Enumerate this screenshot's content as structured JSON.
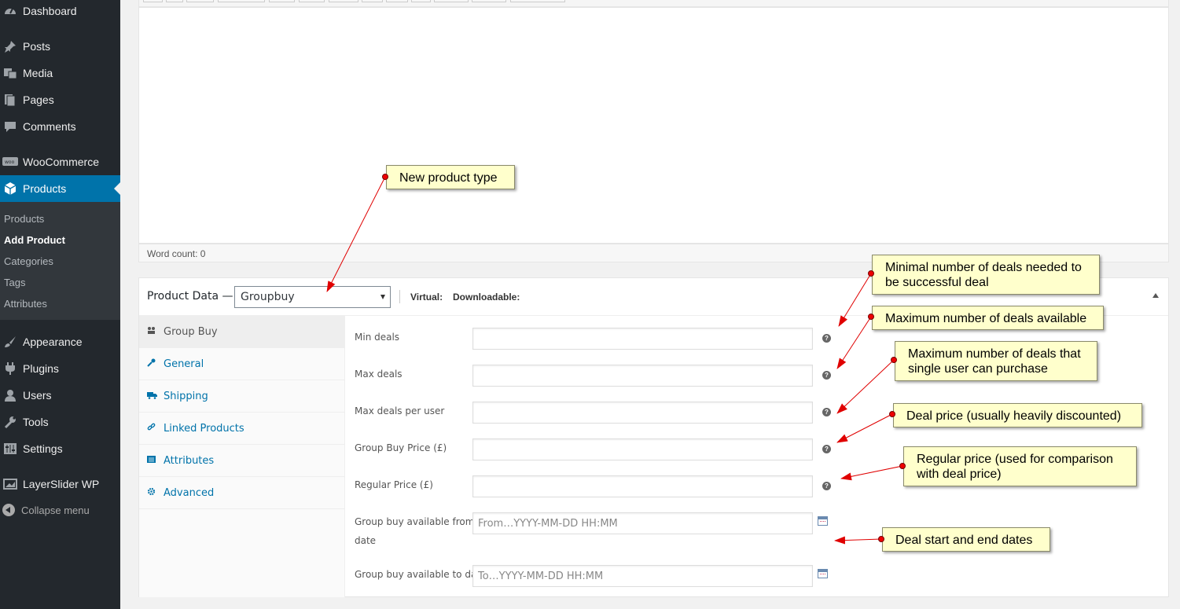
{
  "sidebar": {
    "menu": [
      {
        "label": "Dashboard",
        "icon": "dashboard-icon"
      },
      {
        "label": "Posts",
        "icon": "pin-icon"
      },
      {
        "label": "Media",
        "icon": "media-icon"
      },
      {
        "label": "Pages",
        "icon": "pages-icon"
      },
      {
        "label": "Comments",
        "icon": "comment-icon"
      },
      {
        "label": "WooCommerce",
        "icon": "woocommerce-icon"
      },
      {
        "label": "Products",
        "icon": "box-icon"
      },
      {
        "label": "Appearance",
        "icon": "brush-icon"
      },
      {
        "label": "Plugins",
        "icon": "plug-icon"
      },
      {
        "label": "Users",
        "icon": "user-icon"
      },
      {
        "label": "Tools",
        "icon": "wrench-icon"
      },
      {
        "label": "Settings",
        "icon": "sliders-icon"
      },
      {
        "label": "LayerSlider WP",
        "icon": "layers-icon"
      }
    ],
    "submenu": [
      "Products",
      "Add Product",
      "Categories",
      "Tags",
      "Attributes"
    ],
    "collapse": "Collapse menu"
  },
  "editor": {
    "word_count": "Word count: 0"
  },
  "product_data": {
    "title": "Product Data —",
    "type_selected": "Groupbuy",
    "virtual_label": "Virtual:",
    "downloadable_label": "Downloadable:",
    "tabs": [
      "Group Buy",
      "General",
      "Shipping",
      "Linked Products",
      "Attributes",
      "Advanced"
    ],
    "fields": {
      "min_deals": "Min deals",
      "max_deals": "Max deals",
      "max_per_user": "Max deals per user",
      "group_price": "Group Buy Price (£)",
      "regular_price": "Regular Price (£)",
      "from_line1": "Group buy available from",
      "from_line2": "date",
      "to_label": "Group buy available to date"
    },
    "placeholders": {
      "from": "From…YYYY-MM-DD HH:MM",
      "to": "To…YYYY-MM-DD HH:MM"
    },
    "help_glyph": "?"
  },
  "annotations": {
    "new_type": "New product type",
    "min_deals": "Minimal number of deals needed to be successful deal",
    "max_deals": "Maximum number of deals available",
    "max_per_user": "Maximum number of deals that single user can purchase",
    "deal_price": "Deal price (usually heavily discounted)",
    "regular_price": "Regular price (used for comparison with deal price)",
    "dates": "Deal start and end dates"
  },
  "colors": {
    "sidebar_bg": "#23282d",
    "active_blue": "#0073aa",
    "note_bg": "#ffffcc",
    "arrow_red": "#e00000"
  }
}
